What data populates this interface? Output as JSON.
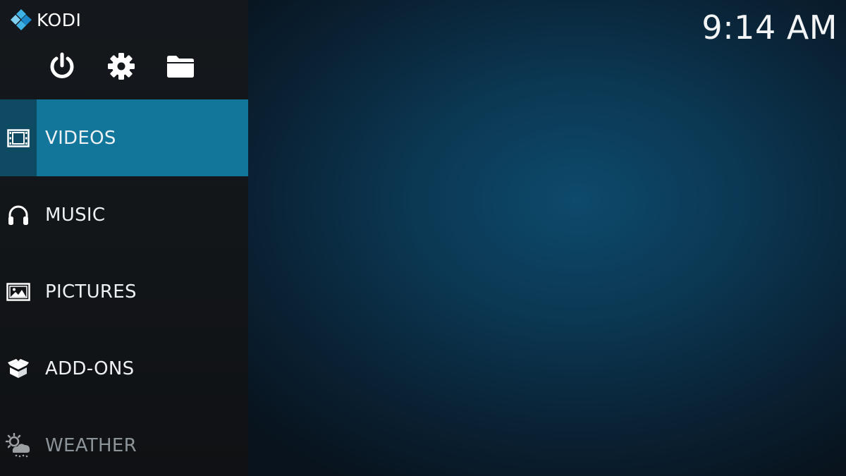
{
  "app": {
    "name": "KODI"
  },
  "header": {
    "clock": "9:14 AM"
  },
  "top_buttons": [
    {
      "icon": "power-icon"
    },
    {
      "icon": "gear-icon"
    },
    {
      "icon": "folder-icon"
    }
  ],
  "menu": {
    "items": [
      {
        "label": "VIDEOS",
        "icon": "film-icon",
        "selected": true
      },
      {
        "label": "MUSIC",
        "icon": "headphones-icon"
      },
      {
        "label": "PICTURES",
        "icon": "picture-icon"
      },
      {
        "label": "ADD-ONS",
        "icon": "box-icon"
      },
      {
        "label": "WEATHER",
        "icon": "weather-icon"
      }
    ]
  },
  "colors": {
    "accent": "#12769b",
    "sidebar": "#14181c",
    "background": "#0b3752"
  }
}
